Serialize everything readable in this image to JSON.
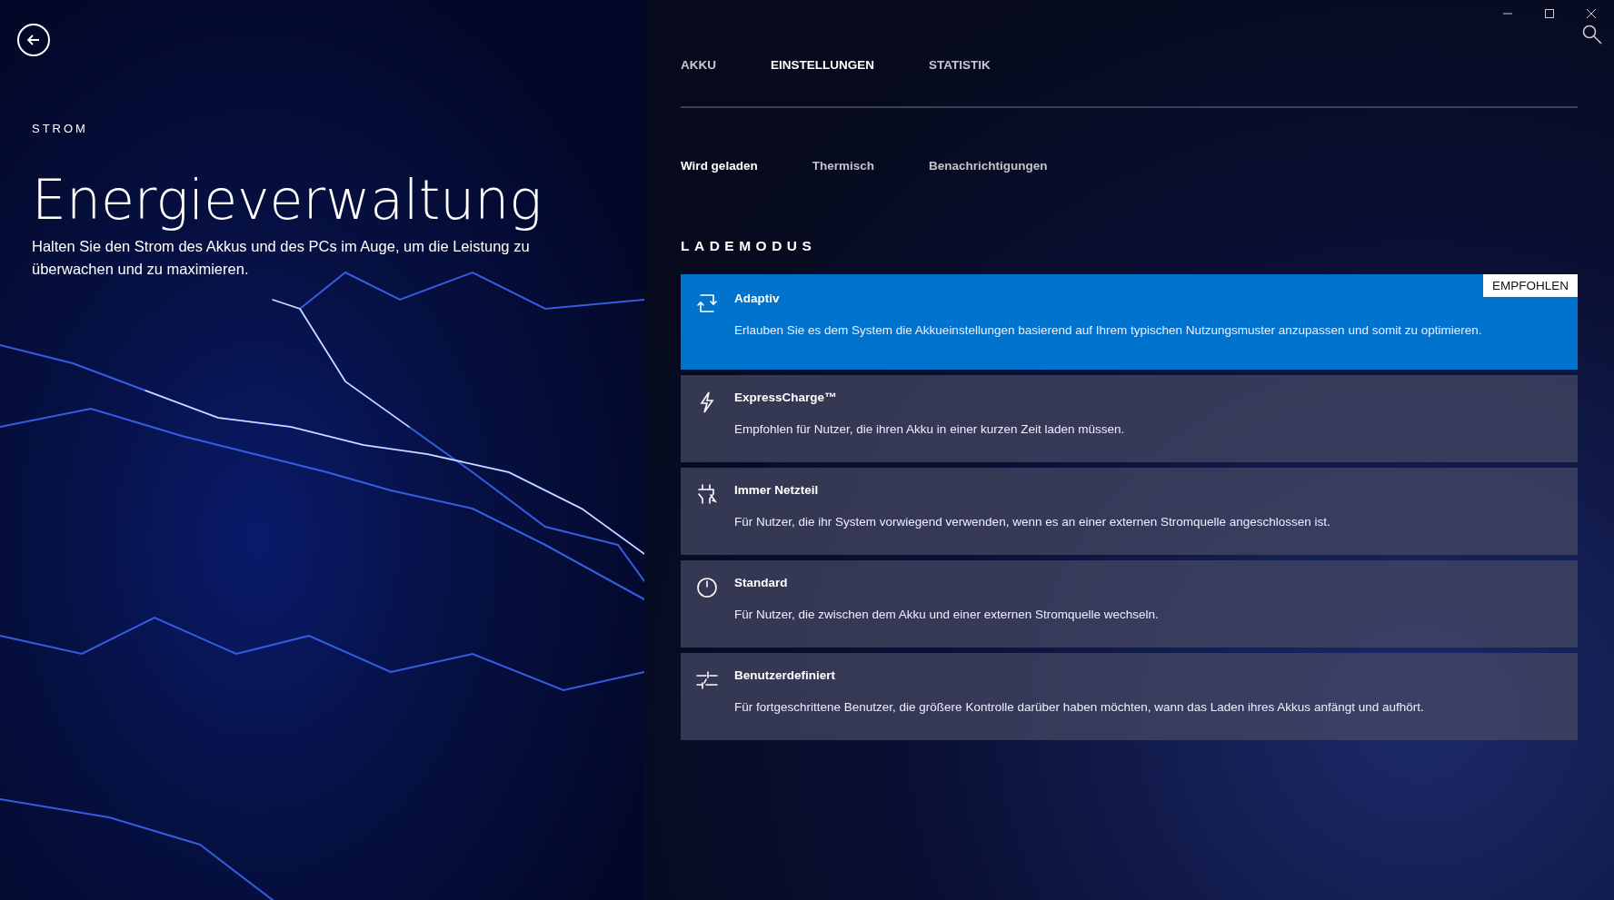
{
  "hero": {
    "eyebrow": "STROM",
    "title": "Energieverwaltung",
    "description": "Halten Sie den Strom des Akkus und des PCs im Auge, um die Leistung zu überwachen und zu maximieren."
  },
  "tabs": [
    {
      "label": "AKKU",
      "selected": false
    },
    {
      "label": "EINSTELLUNGEN",
      "selected": true
    },
    {
      "label": "STATISTIK",
      "selected": false
    }
  ],
  "subtabs": [
    {
      "label": "Wird geladen",
      "selected": true
    },
    {
      "label": "Thermisch",
      "selected": false
    },
    {
      "label": "Benachrichtigungen",
      "selected": false
    }
  ],
  "section_title": "LADEMODUS",
  "modes": [
    {
      "kind": "adaptive",
      "title": "Adaptiv",
      "description": "Erlauben Sie es dem System die Akkueinstellungen basierend auf Ihrem typischen Nutzungsmuster anzupassen und somit zu optimieren.",
      "badge": "EMPFOHLEN",
      "selected": true
    },
    {
      "kind": "express",
      "title": "ExpressCharge™",
      "description": "Empfohlen für Nutzer, die ihren Akku in einer kurzen Zeit laden müssen.",
      "selected": false
    },
    {
      "kind": "ac",
      "title": "Immer Netzteil",
      "description": "Für Nutzer, die ihr System vorwiegend verwenden, wenn es an einer externen Stromquelle angeschlossen ist.",
      "selected": false
    },
    {
      "kind": "standard",
      "title": "Standard",
      "description": "Für Nutzer, die zwischen dem Akku und einer externen Stromquelle wechseln.",
      "selected": false
    },
    {
      "kind": "custom",
      "title": "Benutzerdefiniert",
      "description": "Für fortgeschrittene Benutzer, die größere Kontrolle darüber haben möchten, wann das Laden ihres Akkus anfängt und aufhört.",
      "selected": false
    }
  ]
}
